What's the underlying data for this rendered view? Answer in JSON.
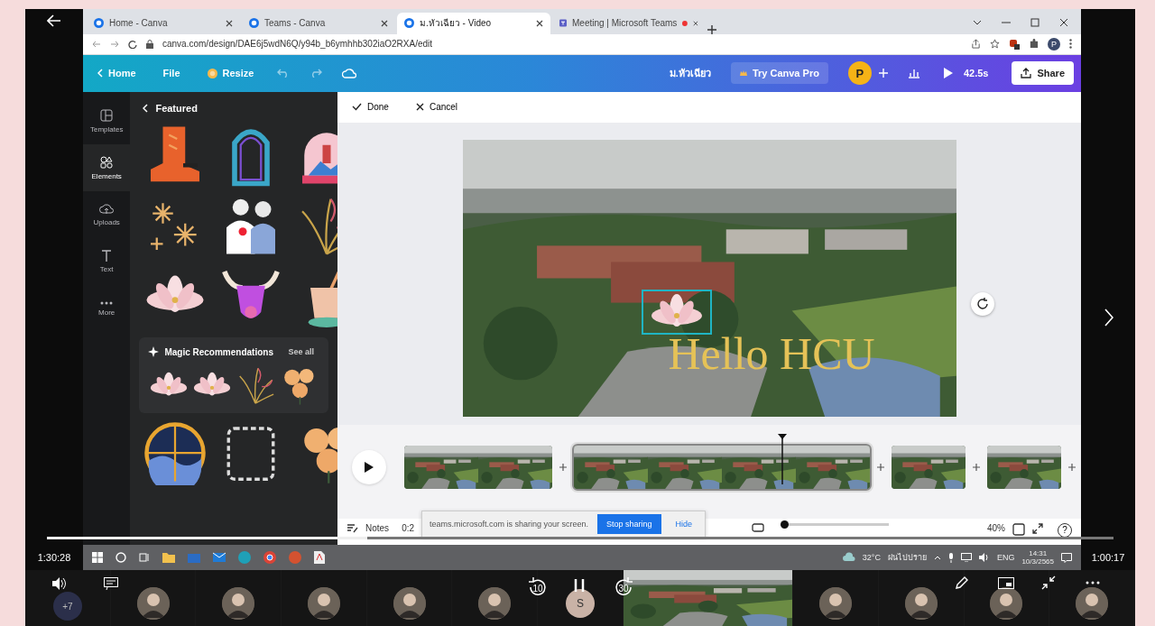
{
  "browser": {
    "tabs": [
      {
        "title": "Home - Canva",
        "selected": false,
        "recording": false
      },
      {
        "title": "Teams - Canva",
        "selected": false,
        "recording": false
      },
      {
        "title": "ม.หัวเฉียว - Video",
        "selected": true,
        "recording": false
      },
      {
        "title": "Meeting | Microsoft Teams",
        "selected": false,
        "recording": true
      }
    ],
    "address": "canva.com/design/DAE6j5wdN6Q/y94b_b6ymhhb302iaO2RXA/edit",
    "profile": "P"
  },
  "canva": {
    "header": {
      "home": "Home",
      "file": "File",
      "resize": "Resize",
      "design_title": "ม.หัวเฉียว",
      "pro": "Try Canva Pro",
      "avatar": "P",
      "duration": "42.5s",
      "share": "Share"
    },
    "sidebar": [
      {
        "label": "Templates",
        "selected": false
      },
      {
        "label": "Elements",
        "selected": true
      },
      {
        "label": "Uploads",
        "selected": false
      },
      {
        "label": "Text",
        "selected": false
      },
      {
        "label": "More",
        "selected": false
      }
    ],
    "panel": {
      "title": "Featured",
      "magic_title": "Magic Recommendations",
      "see_all": "See all"
    },
    "toolbar": {
      "done": "Done",
      "cancel": "Cancel"
    },
    "canvas": {
      "text": "Hello HCU"
    },
    "timeline": [
      {
        "selected": false
      },
      {
        "selected": true
      },
      {
        "selected": false
      },
      {
        "selected": false
      }
    ],
    "footer": {
      "notes": "Notes",
      "time": "0:2",
      "zoom": "40%",
      "help": "?"
    },
    "share_bar": {
      "message": "teams.microsoft.com is sharing your screen.",
      "stop": "Stop sharing",
      "hide": "Hide"
    }
  },
  "taskbar": {
    "temperature": "32°C",
    "condition": "ฝนไปปราย",
    "language": "ENG",
    "time": "14:31",
    "date": "10/3/2565"
  },
  "player": {
    "elapsed": "1:30:28",
    "remaining": "1:00:17",
    "progress": {
      "level": 0.3
    },
    "skip_back": "10",
    "skip_forward": "30"
  },
  "participants": [
    {
      "kind": "overflow",
      "label": "+7"
    },
    {
      "kind": "avatar"
    },
    {
      "kind": "avatar"
    },
    {
      "kind": "avatar"
    },
    {
      "kind": "avatar"
    },
    {
      "kind": "avatar"
    },
    {
      "kind": "initial",
      "label": "S"
    },
    {
      "kind": "video"
    },
    {
      "kind": "avatar"
    },
    {
      "kind": "avatar"
    },
    {
      "kind": "avatar"
    },
    {
      "kind": "avatar"
    }
  ]
}
